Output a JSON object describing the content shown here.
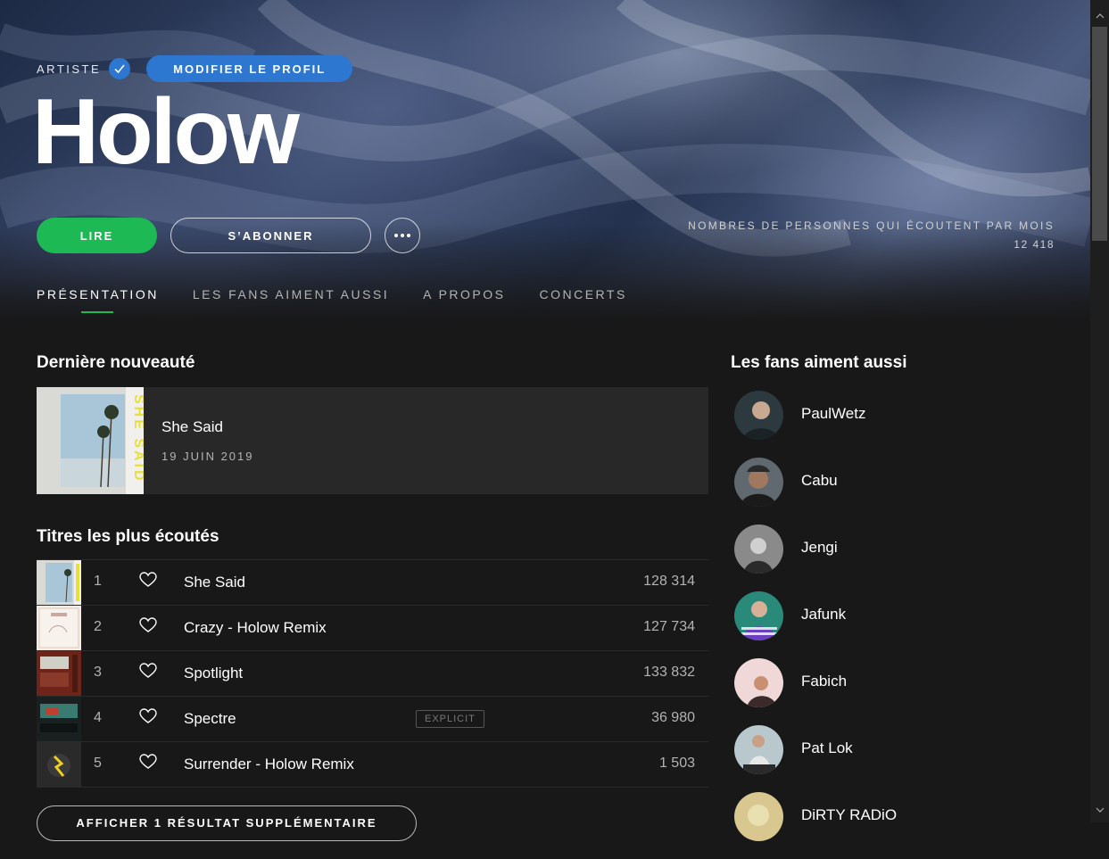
{
  "header": {
    "artist_label": "ARTISTE",
    "edit_profile_label": "MODIFIER LE PROFIL",
    "artist_name": "Holow",
    "play_label": "LIRE",
    "follow_label": "S’ABONNER",
    "monthly_listeners_label": "NOMBRES DE PERSONNES QUI ÉCOUTENT PAR MOIS",
    "monthly_listeners_value": "12 418"
  },
  "tabs": [
    {
      "label": "PRÉSENTATION",
      "active": true
    },
    {
      "label": "LES FANS AIMENT AUSSI",
      "active": false
    },
    {
      "label": "A PROPOS",
      "active": false
    },
    {
      "label": "CONCERTS",
      "active": false
    }
  ],
  "latest_release": {
    "heading": "Dernière nouveauté",
    "title": "She Said",
    "date": "19 JUIN 2019"
  },
  "top_tracks": {
    "heading": "Titres les plus écoutés",
    "tracks": [
      {
        "number": "1",
        "title": "She Said",
        "plays": "128 314"
      },
      {
        "number": "2",
        "title": "Crazy - Holow Remix",
        "plays": "127 734"
      },
      {
        "number": "3",
        "title": "Spotlight",
        "plays": "133 832"
      },
      {
        "number": "4",
        "title": "Spectre",
        "plays": "36 980",
        "explicit": "EXPLICIT"
      },
      {
        "number": "5",
        "title": "Surrender - Holow Remix",
        "plays": "1 503"
      }
    ],
    "show_more_label": "AFFICHER 1 RÉSULTAT SUPPLÉMENTAIRE"
  },
  "fans_also_like": {
    "heading": "Les fans aiment aussi",
    "artists": [
      "PaulWetz",
      "Cabu",
      "Jengi",
      "Jafunk",
      "Fabich",
      "Pat Lok",
      "DiRTY RADiO"
    ]
  },
  "colors": {
    "accent_green": "#1db954",
    "accent_blue": "#2e77d0",
    "background": "#181818",
    "card": "#282828"
  }
}
